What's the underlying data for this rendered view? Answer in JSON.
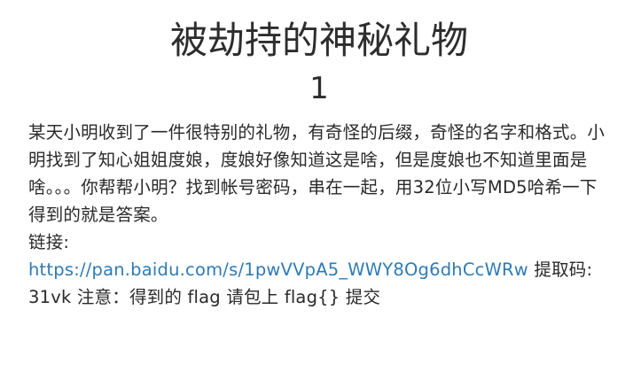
{
  "challenge": {
    "title": "被劫持的神秘礼物",
    "points": "1",
    "description": "某天小明收到了一件很特别的礼物，有奇怪的后缀，奇怪的名字和格式。小明找到了知心姐姐度娘，度娘好像知道这是啥，但是度娘也不知道里面是啥。。。你帮帮小明？找到帐号密码，串在一起，用32位小写MD5哈希一下得到的就是答案。",
    "link_label": "链接:",
    "link_text": "https://pan.baidu.com/s/1pwVVpA5_WWY8Og6dhCcWRw",
    "link_href": "https://pan.baidu.com/s/1pwVVpA5_WWY8Og6dhCcWRw",
    "extract_text": "提取码: 31vk 注意：得到的 flag 请包上 flag{} 提交"
  },
  "colors": {
    "text": "#2a2a2a",
    "link": "#2e7bb6",
    "background": "#ffffff"
  }
}
